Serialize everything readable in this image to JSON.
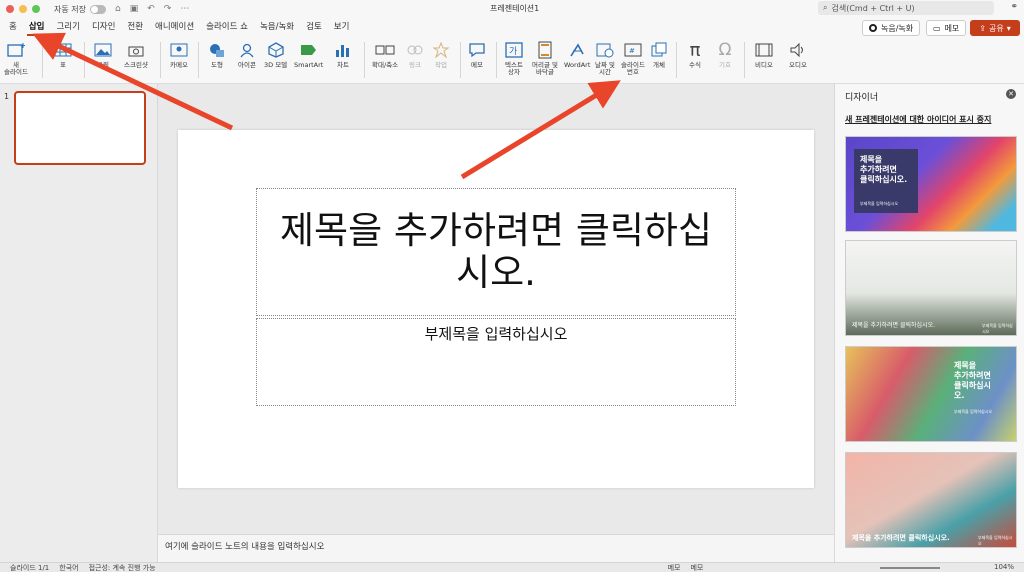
{
  "titlebar": {
    "autosave_label": "자동 저장",
    "doc_title": "프레젠테이션1",
    "search_placeholder": "검색(Cmd + Ctrl + U)"
  },
  "tabs": [
    "홈",
    "삽입",
    "그리기",
    "디자인",
    "전환",
    "애니메이션",
    "슬라이드 쇼",
    "녹음/녹화",
    "검토",
    "보기"
  ],
  "active_tab": "삽입",
  "right_buttons": {
    "record": "녹음/녹화",
    "memo": "메모",
    "share": "공유"
  },
  "ribbon": {
    "new_slide": "새\n슬라이드",
    "table": "표",
    "pictures": "그림",
    "screenshot": "스크린샷",
    "cameo": "카메오",
    "shapes": "도형",
    "icons": "아이콘",
    "models_3d": "3D 모델",
    "smartart": "SmartArt",
    "chart": "차트",
    "zoom": "확대/축소",
    "link": "링크",
    "action": "작업",
    "comment": "메모",
    "textbox": "텍스트\n상자",
    "header_footer": "머리글 및\n바닥글",
    "wordart": "WordArt",
    "date_time": "날짜 및\n시간",
    "slide_number": "슬라이드\n번호",
    "object": "개체",
    "equation": "수식",
    "symbol": "기호",
    "video": "비디오",
    "audio": "오디오"
  },
  "thumbnails": {
    "number": "1"
  },
  "slide": {
    "title_placeholder": "제목을 추가하려면 클릭하십시오.",
    "subtitle_placeholder": "부제목을 입력하십시오"
  },
  "notes_placeholder": "여기에 슬라이드 노트의 내용을 입력하십시오",
  "designer": {
    "title": "디자이너",
    "link": "새 프레젠테이션에 대한 아이디어 표시 중지",
    "design1_title": "제목을\n추가하려면\n클릭하십시오.",
    "design1_sub": "부제목을 입력하십시오",
    "design2_title": "제목을 추가하려면 클릭하십시오.",
    "design2_sub": "부제목을 입력하십시오",
    "design3_title": "제목을\n추가하려면\n클릭하십시\n오.",
    "design3_sub": "부제목을 입력하십시오",
    "design4_title": "제목을 추가하려면 클릭하십시오.",
    "design4_sub": "부제목을 입력하십시오"
  },
  "status": {
    "slide_count": "슬라이드 1/1",
    "language": "한국어",
    "accessibility": "접근성: 계속 진행 가능",
    "notes": "메모",
    "comments": "메모",
    "zoom": "104%"
  },
  "colors": {
    "accent": "#c43e1c",
    "arrow": "#e8452a"
  }
}
